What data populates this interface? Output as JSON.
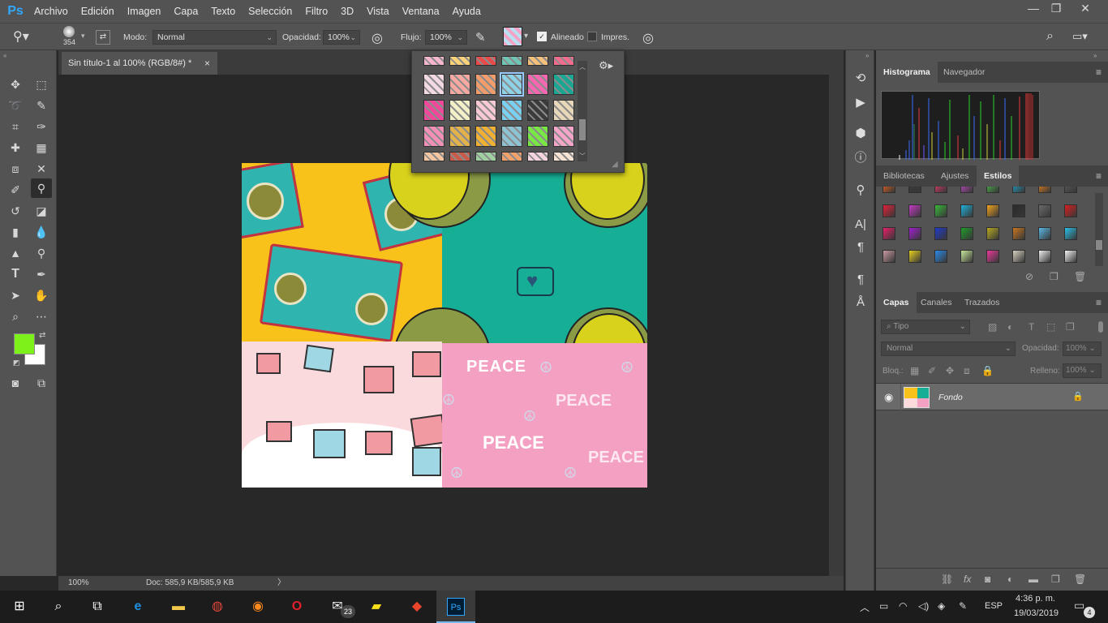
{
  "app": {
    "logo": "Ps"
  },
  "menu": [
    "Archivo",
    "Edición",
    "Imagen",
    "Capa",
    "Texto",
    "Selección",
    "Filtro",
    "3D",
    "Vista",
    "Ventana",
    "Ayuda"
  ],
  "window_controls": {
    "minimize": "—",
    "restore": "❐",
    "close": "✕"
  },
  "options": {
    "brush_size": "354",
    "mode_label": "Modo:",
    "mode_value": "Normal",
    "opacity_label": "Opacidad:",
    "opacity_value": "100%",
    "flow_label": "Flujo:",
    "flow_value": "100%",
    "aligned_label": "Alineado",
    "aligned_checked": true,
    "impressionist_label": "Impres.",
    "impressionist_checked": false
  },
  "document": {
    "tab_title": "Sin título-1 al 100% (RGB/8#) *",
    "close_glyph": "×",
    "zoom": "100%",
    "doc_info": "Doc: 585,9 KB/585,9 KB",
    "status_arrow": "〉"
  },
  "colors": {
    "foreground": "#7cf21a",
    "background": "#ffffff",
    "accent": "#31a8ff",
    "panel": "#535353",
    "dark": "#282828"
  },
  "panels": {
    "top_tabs": [
      "Histograma",
      "Navegador"
    ],
    "mid_tabs": [
      "Bibliotecas",
      "Ajustes",
      "Estilos"
    ],
    "layers_tabs": [
      "Capas",
      "Canales",
      "Trazados"
    ]
  },
  "layers": {
    "filter_placeholder": "Tipo",
    "blend_mode": "Normal",
    "opacity_label": "Opacidad:",
    "opacity_value": "100%",
    "lock_label": "Bloq.:",
    "fill_label": "Relleno:",
    "fill_value": "100%",
    "items": [
      {
        "name": "Fondo",
        "visible": true,
        "locked": true
      }
    ]
  },
  "taskbar": {
    "mail_badge": "23",
    "language": "ESP",
    "time": "4:36 p. m.",
    "date": "19/03/2019",
    "notifications": "4"
  }
}
